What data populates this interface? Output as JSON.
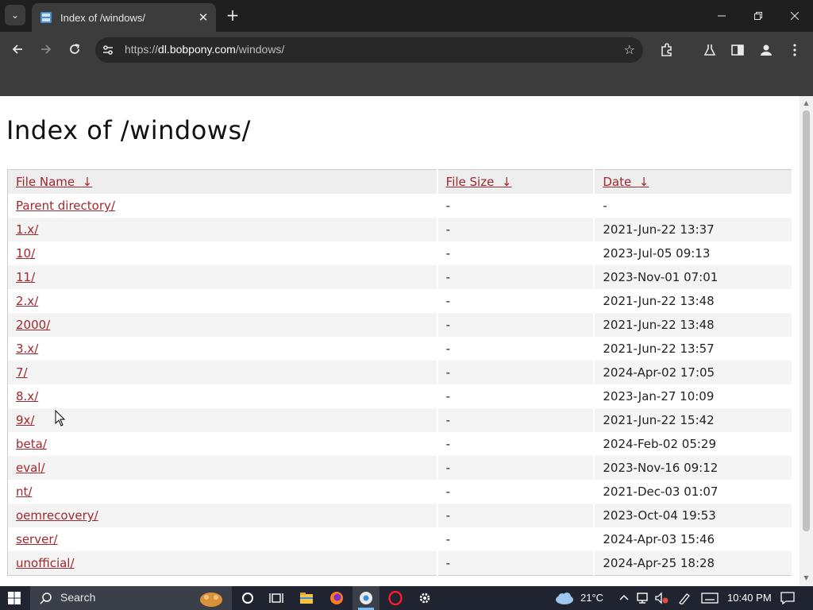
{
  "browser": {
    "tab_title": "Index of /windows/",
    "tab_close": "✕",
    "new_tab": "+",
    "url_scheme": "https://",
    "url_host": "dl.bobpony.com",
    "url_path": "/windows/"
  },
  "page": {
    "heading": "Index of /windows/",
    "columns": [
      {
        "label": "File Name",
        "sort": "↓"
      },
      {
        "label": "File Size",
        "sort": "↓"
      },
      {
        "label": "Date",
        "sort": "↓"
      }
    ],
    "rows": [
      {
        "name": "Parent directory/",
        "size": "-",
        "date": "-"
      },
      {
        "name": "1.x/",
        "size": "-",
        "date": "2021-Jun-22 13:37"
      },
      {
        "name": "10/",
        "size": "-",
        "date": "2023-Jul-05 09:13"
      },
      {
        "name": "11/",
        "size": "-",
        "date": "2023-Nov-01 07:01"
      },
      {
        "name": "2.x/",
        "size": "-",
        "date": "2021-Jun-22 13:48"
      },
      {
        "name": "2000/",
        "size": "-",
        "date": "2021-Jun-22 13:48"
      },
      {
        "name": "3.x/",
        "size": "-",
        "date": "2021-Jun-22 13:57"
      },
      {
        "name": "7/",
        "size": "-",
        "date": "2024-Apr-02 17:05"
      },
      {
        "name": "8.x/",
        "size": "-",
        "date": "2023-Jan-27 10:09"
      },
      {
        "name": "9x/",
        "size": "-",
        "date": "2021-Jun-22 15:42"
      },
      {
        "name": "beta/",
        "size": "-",
        "date": "2024-Feb-02 05:29"
      },
      {
        "name": "eval/",
        "size": "-",
        "date": "2023-Nov-16 09:12"
      },
      {
        "name": "nt/",
        "size": "-",
        "date": "2021-Dec-03 01:07"
      },
      {
        "name": "oemrecovery/",
        "size": "-",
        "date": "2023-Oct-04 19:53"
      },
      {
        "name": "server/",
        "size": "-",
        "date": "2024-Apr-03 15:46"
      },
      {
        "name": "unofficial/",
        "size": "-",
        "date": "2024-Apr-25 18:28"
      }
    ]
  },
  "taskbar": {
    "search_label": "Search",
    "weather": "21°C",
    "time": "10:40 PM"
  },
  "icons": [
    "tab-search-icon",
    "favicon-icon",
    "close-icon",
    "plus-icon",
    "minimize-icon",
    "restore-icon",
    "window-close-icon",
    "back-icon",
    "forward-icon",
    "reload-icon",
    "site-info-icon",
    "star-icon",
    "extensions-icon",
    "labs-icon",
    "side-panel-icon",
    "profile-icon",
    "menu-icon",
    "windows-start-icon",
    "search-icon",
    "cortana-icon",
    "task-view-icon",
    "file-explorer-icon",
    "firefox-icon",
    "chrome-icon",
    "opera-icon",
    "settings-icon",
    "weather-icon",
    "chevron-up-icon",
    "network-icon",
    "volume-muted-icon",
    "pen-icon",
    "keyboard-icon",
    "notification-icon"
  ]
}
